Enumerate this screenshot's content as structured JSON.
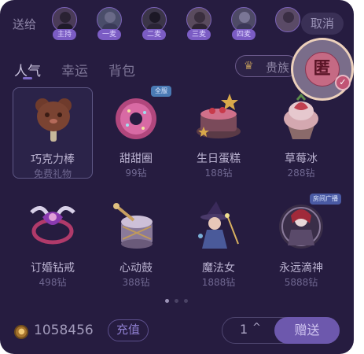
{
  "header": {
    "send_to_label": "送给",
    "cancel_label": "取消",
    "recipients": [
      {
        "tag": "主持",
        "color": "#4a3b58"
      },
      {
        "tag": "一麦",
        "color": "#4a4d6a"
      },
      {
        "tag": "二麦",
        "color": "#3b3548"
      },
      {
        "tag": "三麦",
        "color": "#5a4b5e"
      },
      {
        "tag": "四麦",
        "color": "#4e4a66"
      },
      {
        "tag": "",
        "color": "#5a4a66"
      }
    ]
  },
  "tabs": [
    {
      "label": "人气",
      "active": true
    },
    {
      "label": "幸运",
      "active": false
    },
    {
      "label": "背包",
      "active": false
    }
  ],
  "noble": {
    "label": "贵族",
    "icon": "crown-icon"
  },
  "anonymous": {
    "char": "匿",
    "selected": true,
    "check": "✓"
  },
  "gifts": [
    {
      "name": "巧克力棒",
      "price": "免费礼物",
      "selected": true,
      "badge": ""
    },
    {
      "name": "甜甜圈",
      "price": "99钻",
      "selected": false,
      "badge": "全服"
    },
    {
      "name": "生日蛋糕",
      "price": "188钻",
      "selected": false,
      "badge": ""
    },
    {
      "name": "草莓冰",
      "price": "288钻",
      "selected": false,
      "badge": ""
    },
    {
      "name": "订婚钻戒",
      "price": "498钻",
      "selected": false,
      "badge": ""
    },
    {
      "name": "心动鼓",
      "price": "388钻",
      "selected": false,
      "badge": ""
    },
    {
      "name": "魔法女",
      "price": "1888钻",
      "selected": false,
      "badge": ""
    },
    {
      "name": "永远滴神",
      "price": "5888钻",
      "selected": false,
      "badge": "房间广播"
    }
  ],
  "pagination": {
    "total": 3,
    "current": 1
  },
  "footer": {
    "balance": "1058456",
    "recharge_label": "充值",
    "quantity": "1",
    "quantity_arrow": "^",
    "send_label": "赠送"
  },
  "colors": {
    "panel_bg": "#261c40",
    "accent": "#6d58ad",
    "anon_ring": "#ecd0bb"
  }
}
